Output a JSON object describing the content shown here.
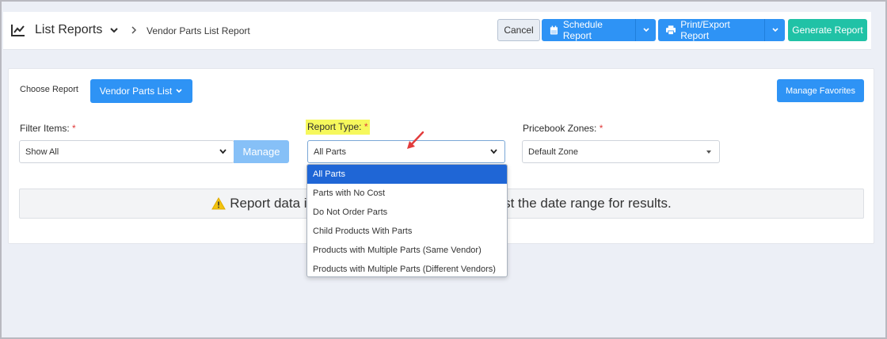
{
  "header": {
    "title": "List Reports",
    "breadcrumb": "Vendor Parts List Report",
    "cancel_label": "Cancel",
    "schedule_label": "Schedule Report",
    "print_label": "Print/Export Report",
    "generate_label": "Generate Report"
  },
  "report": {
    "choose_label": "Choose Report",
    "vendor_button": "Vendor Parts List",
    "favorites_button": "Manage Favorites"
  },
  "filters": {
    "filter_items_label": "Filter Items:",
    "filter_items_value": "Show All",
    "manage_button": "Manage",
    "report_type_label": "Report Type:",
    "report_type_value": "All Parts",
    "pricebook_label": "Pricebook Zones:",
    "pricebook_value": "Default Zone",
    "required_mark": "*"
  },
  "alert": {
    "text_left": "Report data is",
    "text_right": "st the date range for results."
  },
  "dropdown": {
    "options": [
      "All Parts",
      "Parts with No Cost",
      "Do Not Order Parts",
      "Child Products With Parts",
      "Products with Multiple Parts (Same Vendor)",
      "Products with Multiple Parts (Different Vendors)"
    ],
    "selected_index": 0
  },
  "colors": {
    "primary": "#2e93f5",
    "success": "#20c2a6",
    "highlight": "#f6f85c",
    "required": "#e03a3a",
    "selected_option": "#1f66d6"
  }
}
